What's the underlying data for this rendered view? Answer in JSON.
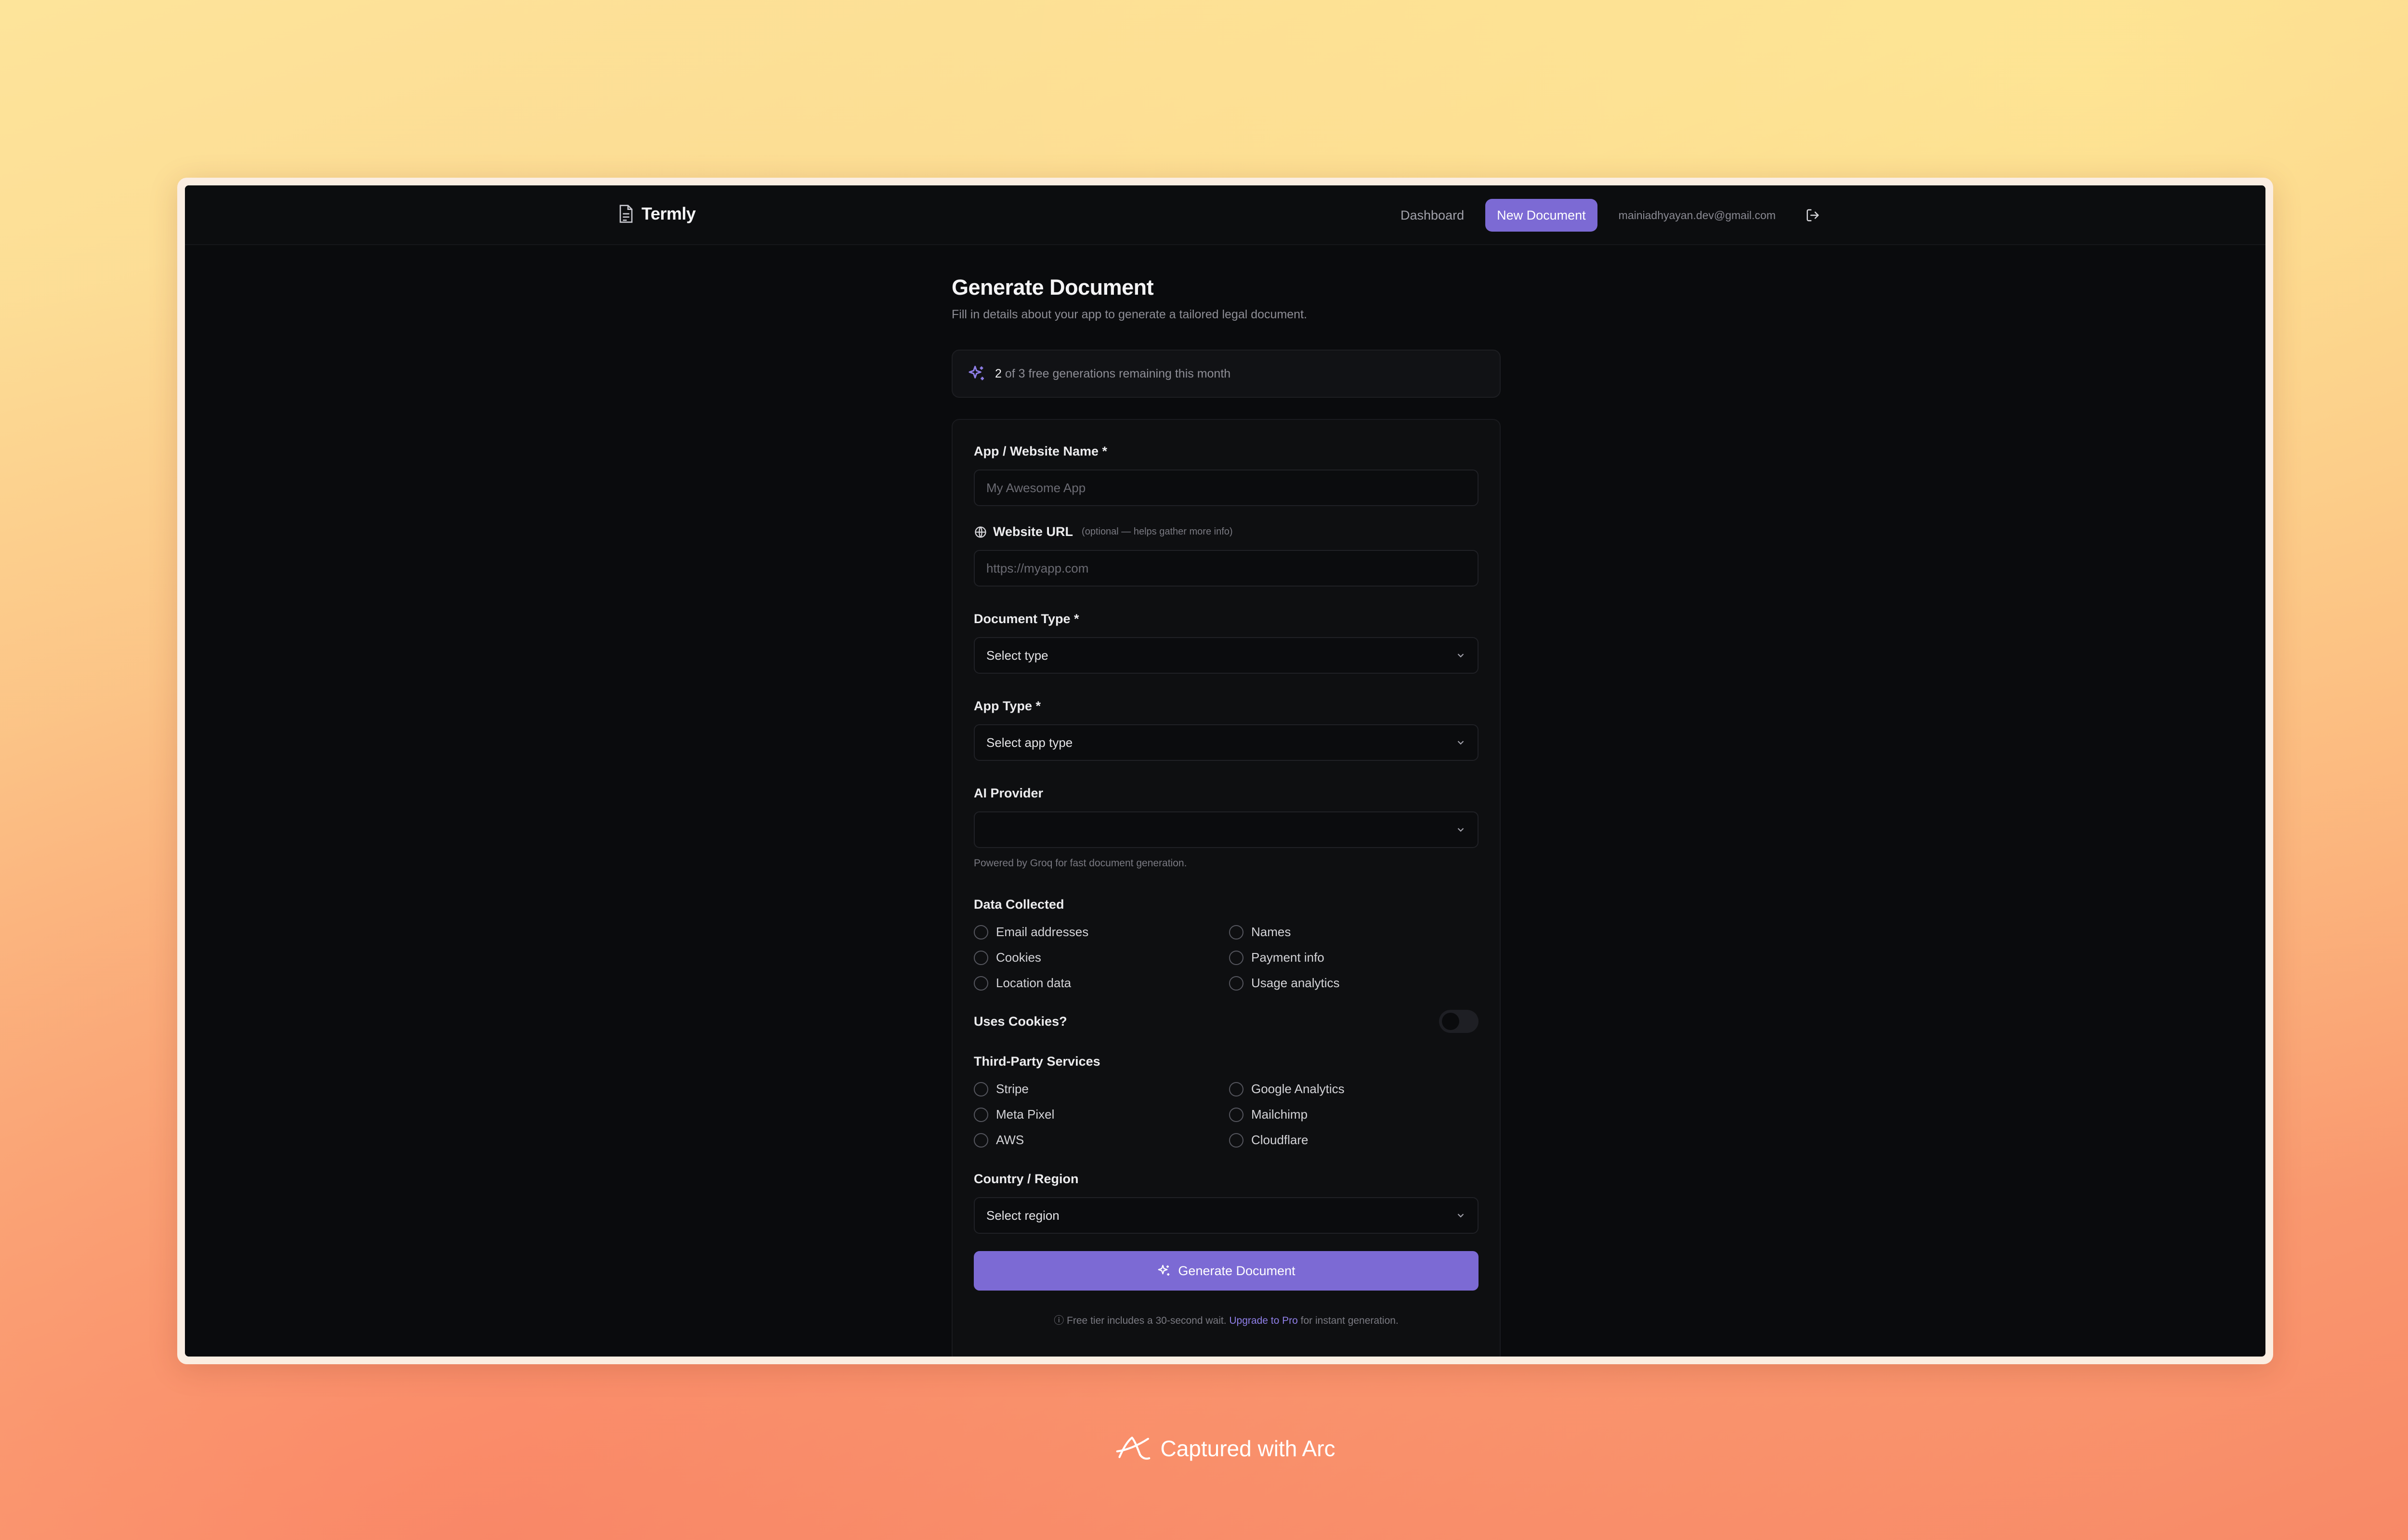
{
  "header": {
    "brand": "Termly",
    "nav": {
      "dashboard": "Dashboard",
      "new_document": "New Document"
    },
    "user_email": "mainiadhyayan.dev@gmail.com"
  },
  "page": {
    "title": "Generate Document",
    "subtitle": "Fill in details about your app to generate a tailored legal document."
  },
  "quota": {
    "used": "2",
    "rest": " of 3 free generations remaining this month"
  },
  "form": {
    "app_name": {
      "label": "App / Website Name *",
      "placeholder": "My Awesome App"
    },
    "website_url": {
      "label": "Website URL",
      "hint": "(optional — helps gather more info)",
      "placeholder": "https://myapp.com"
    },
    "document_type": {
      "label": "Document Type *",
      "value": "Select type"
    },
    "app_type": {
      "label": "App Type *",
      "value": "Select app type"
    },
    "ai_provider": {
      "label": "AI Provider",
      "value": "",
      "helper": "Powered by Groq for fast document generation."
    },
    "data_collected": {
      "label": "Data Collected",
      "options": [
        "Email addresses",
        "Names",
        "Cookies",
        "Payment info",
        "Location data",
        "Usage analytics"
      ]
    },
    "uses_cookies": {
      "label": "Uses Cookies?",
      "enabled": false
    },
    "third_party": {
      "label": "Third-Party Services",
      "options": [
        "Stripe",
        "Google Analytics",
        "Meta Pixel",
        "Mailchimp",
        "AWS",
        "Cloudflare"
      ]
    },
    "region": {
      "label": "Country / Region",
      "value": "Select region"
    },
    "submit_label": "Generate Document",
    "footnote": {
      "pre": "ⓘ Free tier includes a 30-second wait. ",
      "link": "Upgrade to Pro",
      "post": " for instant generation."
    }
  },
  "caption": "Captured with Arc",
  "colors": {
    "accent": "#7c6ad4",
    "background": "#0a0b0d"
  },
  "icons": [
    "document-icon",
    "logout-icon",
    "sparkles-icon",
    "globe-icon",
    "chevron-down-icon",
    "arc-logo-icon"
  ]
}
